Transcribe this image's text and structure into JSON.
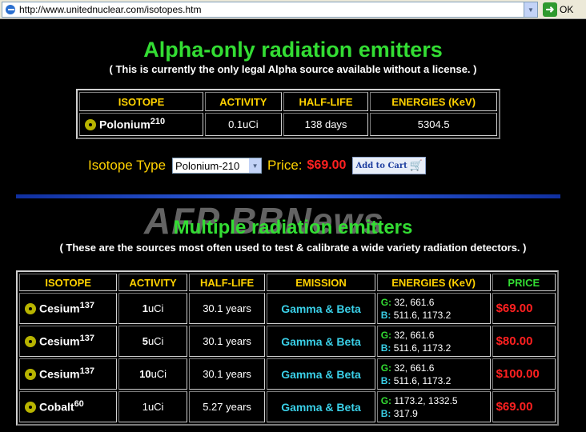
{
  "browser": {
    "url": "http://www.unitednuclear.com/isotopes.htm",
    "go_label": "OK"
  },
  "alpha": {
    "title": "Alpha-only radiation emitters",
    "subtitle": "( This is currently the only legal Alpha source available without a license. )",
    "headers": [
      "ISOTOPE",
      "ACTIVITY",
      "HALF-LIFE",
      "ENERGIES (KeV)"
    ],
    "row": {
      "isotope": "Polonium",
      "mass": "210",
      "activity": "0.1uCi",
      "half_life": "138 days",
      "energies": "5304.5"
    }
  },
  "order": {
    "label": "Isotope Type",
    "selected": "Polonium-210",
    "price_label": "Price:",
    "price": "$69.00",
    "cart_label": "Add to Cart"
  },
  "watermark": "AFP BBNews",
  "multiple": {
    "title": "Multiple radiation emitters",
    "subtitle": "( These are the sources most often used to test & calibrate a wide variety radiation detectors. )",
    "headers": [
      "ISOTOPE",
      "ACTIVITY",
      "HALF-LIFE",
      "EMISSION",
      "ENERGIES (KeV)",
      "PRICE"
    ],
    "rows": [
      {
        "isotope": "Cesium",
        "mass": "137",
        "act_num": "1",
        "act_unit": "uCi",
        "half_life": "30.1 years",
        "emission": "Gamma & Beta",
        "g": "32, 661.6",
        "b": "511.6, 1173.2",
        "price": "$69.00"
      },
      {
        "isotope": "Cesium",
        "mass": "137",
        "act_num": "5",
        "act_unit": "uCi",
        "half_life": "30.1 years",
        "emission": "Gamma & Beta",
        "g": "32, 661.6",
        "b": "511.6, 1173.2",
        "price": "$80.00"
      },
      {
        "isotope": "Cesium",
        "mass": "137",
        "act_num": "10",
        "act_unit": "uCi",
        "half_life": "30.1 years",
        "emission": "Gamma & Beta",
        "g": "32, 661.6",
        "b": "511.6, 1173.2",
        "price": "$100.00"
      },
      {
        "isotope": "Cobalt",
        "mass": "60",
        "act_num": "1",
        "act_unit": "uCi",
        "half_life": "5.27 years",
        "emission": "Gamma & Beta",
        "g": "1173.2, 1332.5",
        "b": "317.9",
        "price": "$69.00"
      }
    ],
    "g_prefix": "G:",
    "b_prefix": "B:"
  }
}
